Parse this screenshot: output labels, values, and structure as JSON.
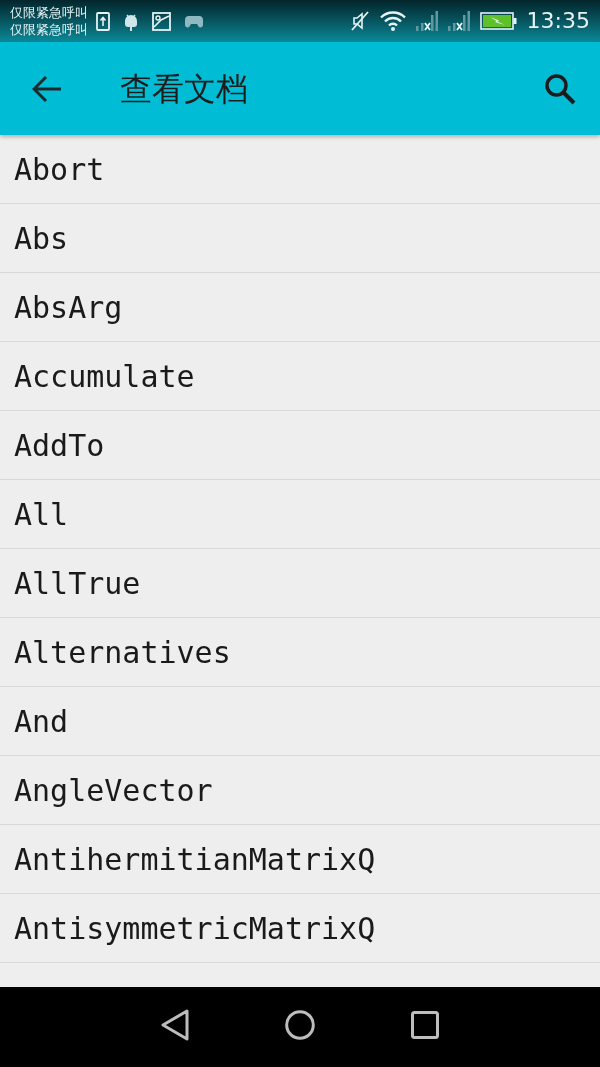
{
  "status_bar": {
    "carrier_lines": [
      "仅限紧急呼叫",
      "仅限紧急呼叫"
    ],
    "battery_charging": true,
    "time": "13:35"
  },
  "app_bar": {
    "title": "查看文档"
  },
  "items": [
    {
      "label": "Abort"
    },
    {
      "label": "Abs"
    },
    {
      "label": "AbsArg"
    },
    {
      "label": "Accumulate"
    },
    {
      "label": "AddTo"
    },
    {
      "label": "All"
    },
    {
      "label": "AllTrue"
    },
    {
      "label": "Alternatives"
    },
    {
      "label": "And"
    },
    {
      "label": "AngleVector"
    },
    {
      "label": "AntihermitianMatrixQ"
    },
    {
      "label": "AntisymmetricMatrixQ"
    }
  ]
}
